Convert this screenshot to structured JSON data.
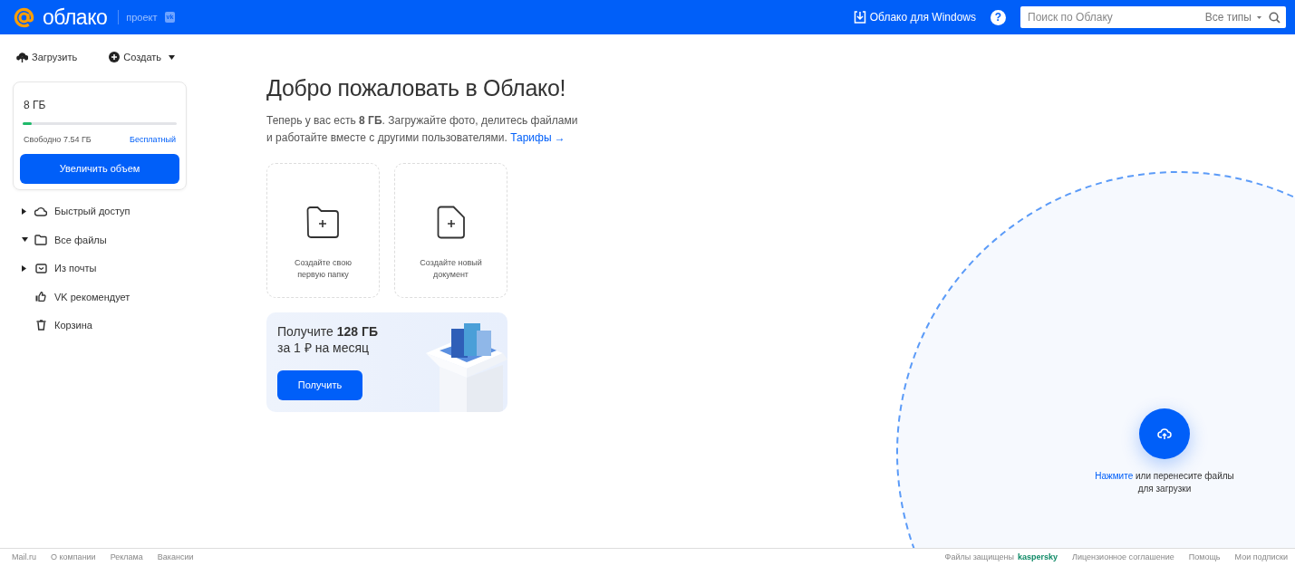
{
  "header": {
    "logo": "облако",
    "project_label": "проект",
    "project_badge": "vk",
    "windows_link": "Облако для Windows",
    "help": "?",
    "search": {
      "placeholder": "Поиск по Облаку",
      "filter": "Все типы"
    }
  },
  "toolbar": {
    "upload": "Загрузить",
    "create": "Создать"
  },
  "storage": {
    "total": "8 ГБ",
    "level": 0.06,
    "free": "Свободно 7.54 ГБ",
    "plan": "Бесплатный",
    "button": "Увеличить объем"
  },
  "sidebar": {
    "items": [
      {
        "label": "Быстрый доступ",
        "kind": "cloud",
        "expanded": false
      },
      {
        "label": "Все файлы",
        "kind": "folder",
        "expanded": true
      },
      {
        "label": "Из почты",
        "kind": "mail",
        "expanded": false
      },
      {
        "label": "VK рекомендует",
        "kind": "like"
      },
      {
        "label": "Корзина",
        "kind": "trash"
      }
    ]
  },
  "welcome": {
    "title": "Добро пожаловать в Облако!",
    "text": "Теперь у вас есть **8 ГБ**. Загружайте фото, делитесь файлами и работайте вместе с другими пользователями.",
    "link": "Тарифы →"
  },
  "create_cards": [
    {
      "kind": "folder",
      "label": "Создайте свою первую папку"
    },
    {
      "kind": "document",
      "label": "Создайте новый документ"
    }
  ],
  "promo": {
    "title": "Получите **128 ГБ**",
    "subtitle": "за 1 ₽ на месяц",
    "button": "Получить"
  },
  "dropzone": {
    "link": "Нажмите",
    "text": "или перенесите файлы для загрузки"
  },
  "footer": {
    "left": [
      "Mail.ru",
      "О компании",
      "Реклама",
      "Вакансии"
    ],
    "protected": "Файлы защищены",
    "protected_brand": "kaspersky",
    "right": [
      "Лицензионное соглашение",
      "Помощь",
      "Мои подписки"
    ]
  }
}
